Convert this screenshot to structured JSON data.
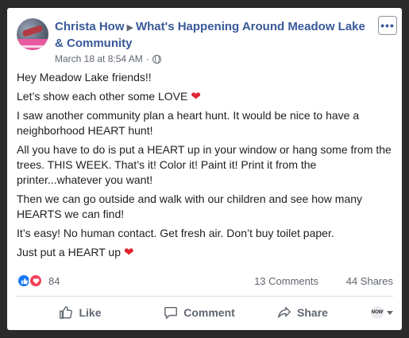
{
  "post": {
    "author": "Christa How",
    "group": "What's Happening Around Meadow Lake & Community",
    "timestamp": "March 18 at 8:54 AM",
    "separator": "·",
    "privacy_icon": "globe-icon",
    "more_icon": "more-icon",
    "body": [
      "Hey Meadow Lake friends!!",
      "Let’s show each other some LOVE",
      "I saw another community plan a heart hunt. It would be nice to have a neighborhood HEART hunt!",
      "All you have to do is put a HEART up in your window or hang some from the trees. THIS WEEK. That’s it! Color it! Paint it! Print it from the printer...whatever you want!",
      "Then we can go outside and walk with our children and see how many HEARTS we can find!",
      "It’s easy! No human contact. Get fresh air. Don’t buy toilet paper.",
      "Just put a HEART up"
    ],
    "heart_emoji": "❤"
  },
  "stats": {
    "reactions_count": "84",
    "comments": "13 Comments",
    "shares": "44 Shares",
    "reaction_icons": [
      "like-icon",
      "love-icon"
    ]
  },
  "actions": {
    "like_label": "Like",
    "comment_label": "Comment",
    "share_label": "Share",
    "audience_label": "NOW"
  },
  "colors": {
    "link": "#385898",
    "like_blue": "#1877f2",
    "love_red": "#f33e58",
    "heart": "#e0232e",
    "muted": "#606770"
  }
}
